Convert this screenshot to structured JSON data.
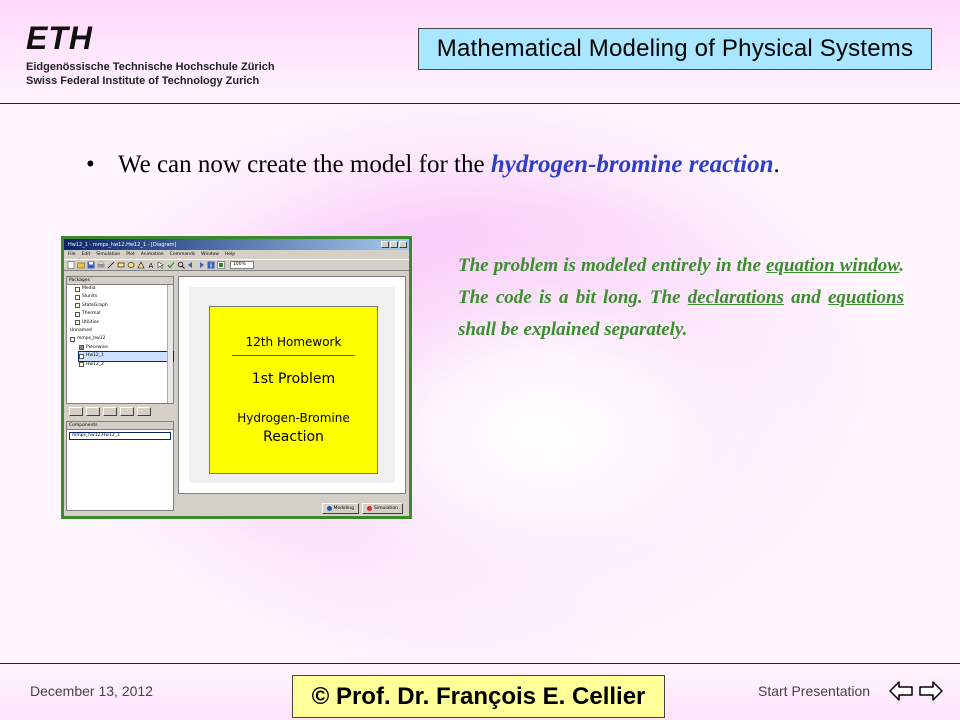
{
  "header": {
    "logo_wordmark": "ETH",
    "logo_line1": "Eidgenössische Technische Hochschule Zürich",
    "logo_line2": "Swiss Federal Institute of Technology Zurich",
    "title": "Mathematical Modeling of Physical Systems"
  },
  "main": {
    "bullet": "•",
    "text_before": "We can now create the model for the ",
    "emphasis": "hydrogen-bromine reaction",
    "text_after": "."
  },
  "screenshot": {
    "window_title": "Hw12_1 - mmps_hw12.Hw12_1 - [Diagram]",
    "menus": [
      "File",
      "Edit",
      "Simulation",
      "Plot",
      "Animation",
      "Commands",
      "Window",
      "Help"
    ],
    "zoom": "100%",
    "packages_header": "Packages",
    "tree": [
      {
        "label": "Media",
        "selected": false
      },
      {
        "label": "SIunits",
        "selected": false
      },
      {
        "label": "StateGraph",
        "selected": false
      },
      {
        "label": "Thermal",
        "selected": false
      },
      {
        "label": "Utilities",
        "selected": false
      },
      {
        "label": "Unnamed",
        "selected": false
      },
      {
        "label": "mmps_hw12",
        "selected": false
      },
      {
        "label": "Piecewise",
        "selected": false
      },
      {
        "label": "Hw12_1",
        "selected": true
      },
      {
        "label": "Hw12_2",
        "selected": false
      }
    ],
    "components_header": "Components",
    "component_item": "mmps_hw12.Hw12_1",
    "diagram_card": {
      "line1": "12th Homework",
      "line2": "1st Problem",
      "line3": "Hydrogen-Bromine",
      "line4": "Reaction"
    },
    "mode_modeling": "Modeling",
    "mode_simulation": "Simulation"
  },
  "description": {
    "p1": "The problem is modeled entirely in the ",
    "u1": "equation window",
    "p2": ".  The code is a bit long.  The ",
    "u2": "declarations",
    "p3": " and ",
    "u3": "equations",
    "p4": " shall be explained separately."
  },
  "footer": {
    "date": "December 13, 2012",
    "copyright": "© Prof. Dr. François E. Cellier",
    "start_presentation": "Start Presentation"
  },
  "colors": {
    "title_box": "#a9e6ff",
    "copyright_box": "#ffff9a",
    "emphasis_blue": "#2d3fc7",
    "description_green": "#3a8e2e",
    "screenshot_border": "#3c8a2e",
    "diagram_card": "#ffff00"
  }
}
